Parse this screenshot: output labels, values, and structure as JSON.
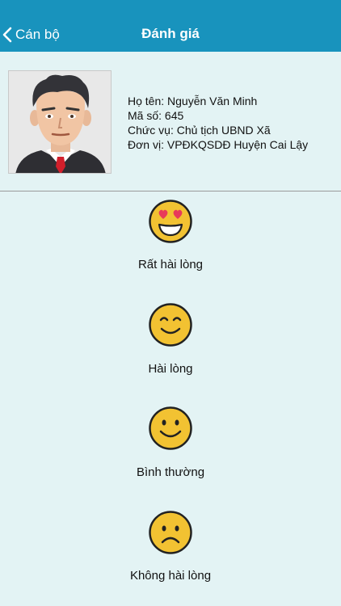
{
  "navbar": {
    "back_label": "Cán bộ",
    "title": "Đánh giá"
  },
  "profile": {
    "name": "Họ tên: Nguyễn Văn Minh",
    "code": "Mã số: 645",
    "position": "Chức vụ: Chủ tịch UBND Xã",
    "unit": "Đơn vị: VPĐKQSDĐ  Huyện Cai Lậy"
  },
  "ratings": [
    {
      "label": "Rất hài lòng",
      "icon": "heart-eyes-face-icon"
    },
    {
      "label": "Hài lòng",
      "icon": "happy-face-icon"
    },
    {
      "label": "Bình thường",
      "icon": "smile-face-icon"
    },
    {
      "label": "Không hài lòng",
      "icon": "sad-face-icon"
    }
  ],
  "colors": {
    "navbar": "#1893bd",
    "background": "#e3f3f4",
    "emoji_fill": "#f2c232"
  }
}
